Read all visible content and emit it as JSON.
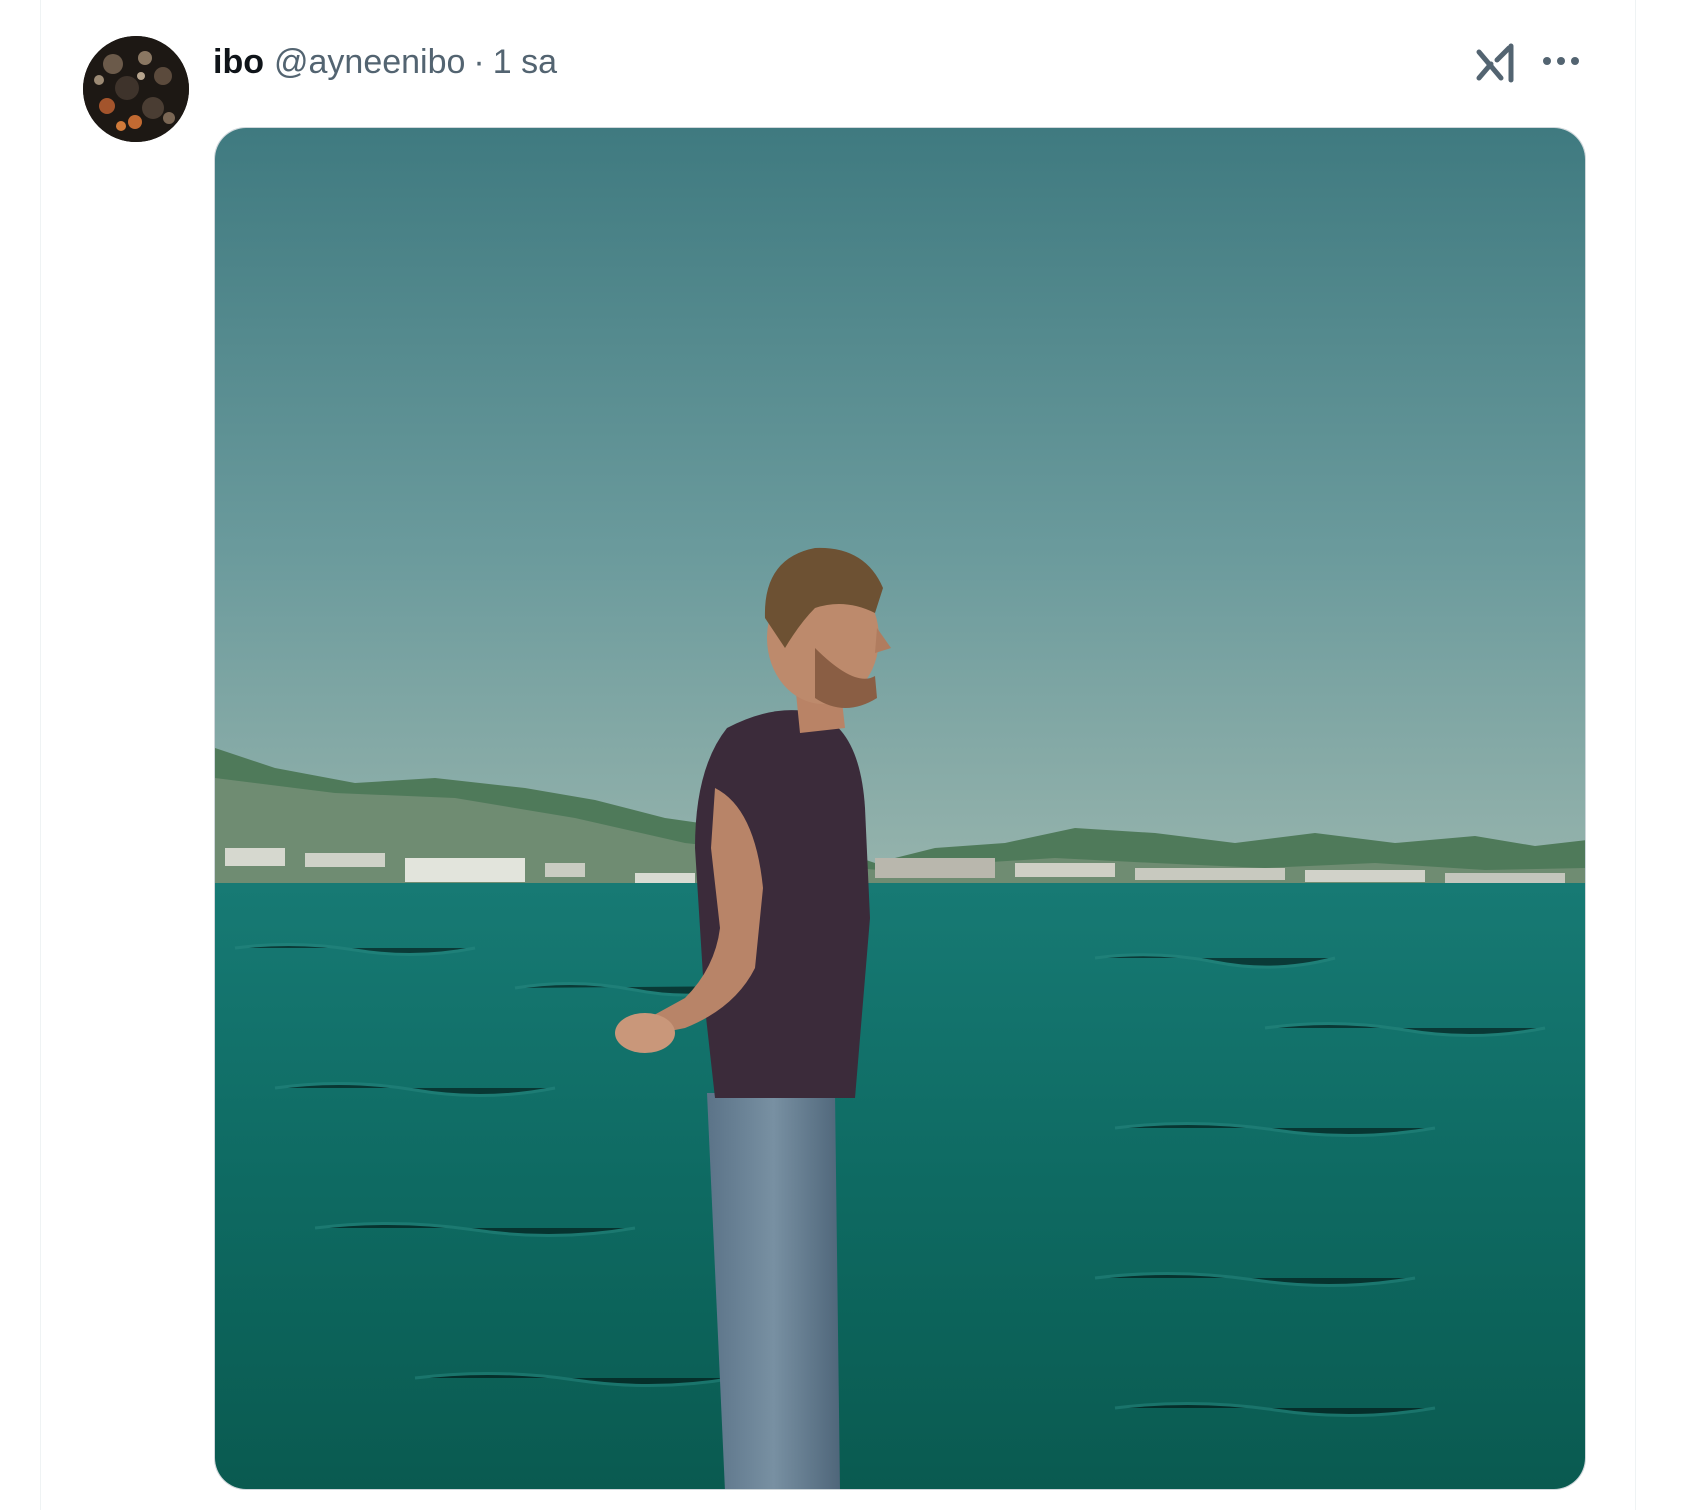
{
  "post": {
    "author": {
      "display_name": "ibo",
      "handle": "@ayneenibo"
    },
    "separator": "·",
    "timestamp": "1 sa",
    "icons": {
      "grok": "xai-grok-icon",
      "more": "more-options-icon"
    },
    "media": {
      "kind": "photo"
    }
  },
  "colors": {
    "text_primary": "#0f1419",
    "text_secondary": "#536471",
    "sky": "#5f9396",
    "sea": "#0d6d66"
  }
}
